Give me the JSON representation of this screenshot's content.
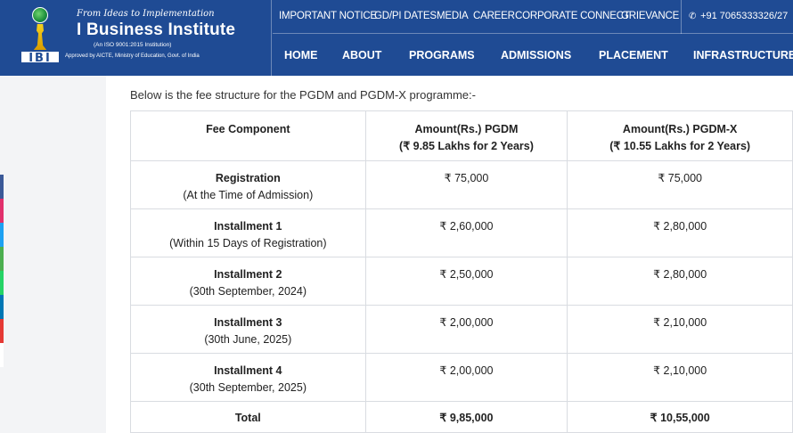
{
  "brand": {
    "tagline": "From Ideas to Implementation",
    "name": "I Business Institute",
    "iso": "(An ISO 9001:2015 Institution)",
    "approved": "Approved by AICTE, Ministry of Education, Govt. of India",
    "logo_text": "IBI"
  },
  "top_links": [
    "IMPORTANT NOTICE",
    "GD/PI DATES",
    "MEDIA",
    "CAREER",
    "CORPORATE CONNECT",
    "GRIEVANCE"
  ],
  "phone": "+91 7065333326/27",
  "nav": [
    "HOME",
    "ABOUT",
    "PROGRAMS",
    "ADMISSIONS",
    "PLACEMENT",
    "INFRASTRUCTURE"
  ],
  "colors": {
    "header_bg": "#1f4b94",
    "side_tabs": [
      "#3b5998",
      "#e1306c",
      "#1da1f2",
      "#4caf50",
      "#25d366",
      "#0077b5",
      "#e53935",
      "#ffffff"
    ]
  },
  "content": {
    "intro": "Below is the fee structure for the PGDM and PGDM-X programme:-",
    "table": {
      "headers": [
        {
          "line1": "Fee Component",
          "line2": ""
        },
        {
          "line1": "Amount(Rs.) PGDM",
          "line2": "(₹ 9.85 Lakhs for 2 Years)"
        },
        {
          "line1": "Amount(Rs.) PGDM-X",
          "line2": "(₹ 10.55 Lakhs for 2 Years)"
        }
      ],
      "rows": [
        {
          "title": "Registration",
          "sub": "(At the Time of Admission)",
          "pgdm": "₹ 75,000",
          "pgdmx": "₹ 75,000"
        },
        {
          "title": "Installment 1",
          "sub": "(Within 15 Days of Registration)",
          "pgdm": "₹ 2,60,000",
          "pgdmx": "₹ 2,80,000"
        },
        {
          "title": "Installment 2",
          "sub": "(30th September, 2024)",
          "pgdm": "₹ 2,50,000",
          "pgdmx": "₹ 2,80,000"
        },
        {
          "title": "Installment 3",
          "sub": "(30th June, 2025)",
          "pgdm": "₹ 2,00,000",
          "pgdmx": "₹ 2,10,000"
        },
        {
          "title": "Installment 4",
          "sub": "(30th September, 2025)",
          "pgdm": "₹ 2,00,000",
          "pgdmx": "₹ 2,10,000"
        }
      ],
      "total": {
        "label": "Total",
        "pgdm": "₹ 9,85,000",
        "pgdmx": "₹ 10,55,000"
      }
    }
  }
}
